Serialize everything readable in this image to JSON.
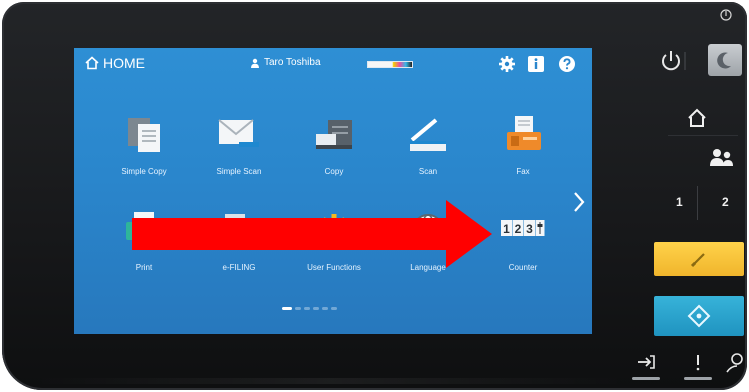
{
  "screen": {
    "home_label": "HOME",
    "user_name": "Taro Toshiba",
    "top_icons": [
      "gear-icon",
      "info-icon",
      "help-icon"
    ]
  },
  "apps": [
    {
      "name": "simple-copy",
      "label": "Simple Copy",
      "icon": "simple-copy-icon"
    },
    {
      "name": "simple-scan",
      "label": "Simple Scan",
      "icon": "simple-scan-icon"
    },
    {
      "name": "copy",
      "label": "Copy",
      "icon": "copy-icon"
    },
    {
      "name": "scan",
      "label": "Scan",
      "icon": "scan-icon"
    },
    {
      "name": "fax",
      "label": "Fax",
      "icon": "fax-icon"
    },
    {
      "name": "print",
      "label": "Print",
      "icon": "print-icon"
    },
    {
      "name": "e-filing",
      "label": "e-FILING",
      "icon": "e-filing-icon"
    },
    {
      "name": "user-functions",
      "label": "User Functions",
      "icon": "user-functions-icon"
    },
    {
      "name": "language",
      "label": "Language",
      "icon": "language-icon"
    },
    {
      "name": "counter",
      "label": "Counter",
      "icon": "counter-icon"
    }
  ],
  "counter_digits": "123",
  "pager": {
    "pages": 6,
    "current": 1
  },
  "hardware": {
    "one_label": "1",
    "two_label": "2"
  },
  "colors": {
    "screen_blue": "#2a86cc",
    "highlight_arrow": "#ff0000",
    "reset_button": "#f0b52c",
    "start_button": "#1f93c0"
  }
}
